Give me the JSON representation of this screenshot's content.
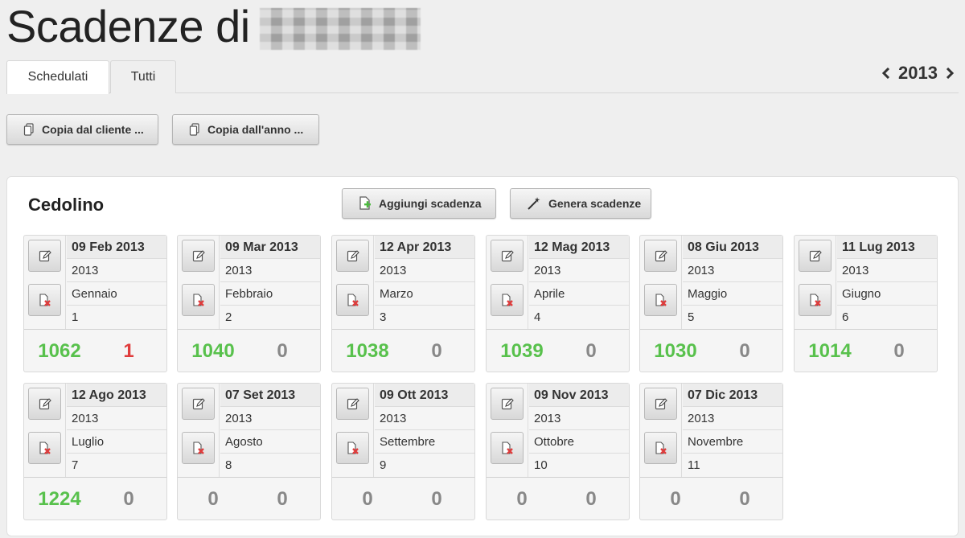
{
  "page": {
    "title": "Scadenze di"
  },
  "tabs": [
    {
      "label": "Schedulati",
      "active": true
    },
    {
      "label": "Tutti",
      "active": false
    }
  ],
  "year_nav": {
    "year": "2013"
  },
  "toolbar": {
    "copy_client_label": "Copia dal cliente ...",
    "copy_year_label": "Copia dall'anno ..."
  },
  "panel": {
    "title": "Cedolino",
    "add_label": "Aggiungi scadenza",
    "generate_label": "Genera scadenze"
  },
  "colors": {
    "positive": "#58c14c",
    "negative": "#e03c3c",
    "zero": "#888888"
  },
  "deadlines": [
    {
      "date": "09 Feb 2013",
      "year": "2013",
      "month": "Gennaio",
      "number": "1",
      "left": "1062",
      "right": "1"
    },
    {
      "date": "09 Mar 2013",
      "year": "2013",
      "month": "Febbraio",
      "number": "2",
      "left": "1040",
      "right": "0"
    },
    {
      "date": "12 Apr 2013",
      "year": "2013",
      "month": "Marzo",
      "number": "3",
      "left": "1038",
      "right": "0"
    },
    {
      "date": "12 Mag 2013",
      "year": "2013",
      "month": "Aprile",
      "number": "4",
      "left": "1039",
      "right": "0"
    },
    {
      "date": "08 Giu 2013",
      "year": "2013",
      "month": "Maggio",
      "number": "5",
      "left": "1030",
      "right": "0"
    },
    {
      "date": "11 Lug 2013",
      "year": "2013",
      "month": "Giugno",
      "number": "6",
      "left": "1014",
      "right": "0"
    },
    {
      "date": "12 Ago 2013",
      "year": "2013",
      "month": "Luglio",
      "number": "7",
      "left": "1224",
      "right": "0"
    },
    {
      "date": "07 Set 2013",
      "year": "2013",
      "month": "Agosto",
      "number": "8",
      "left": "0",
      "right": "0"
    },
    {
      "date": "09 Ott 2013",
      "year": "2013",
      "month": "Settembre",
      "number": "9",
      "left": "0",
      "right": "0"
    },
    {
      "date": "09 Nov 2013",
      "year": "2013",
      "month": "Ottobre",
      "number": "10",
      "left": "0",
      "right": "0"
    },
    {
      "date": "07 Dic 2013",
      "year": "2013",
      "month": "Novembre",
      "number": "11",
      "left": "0",
      "right": "0"
    }
  ]
}
